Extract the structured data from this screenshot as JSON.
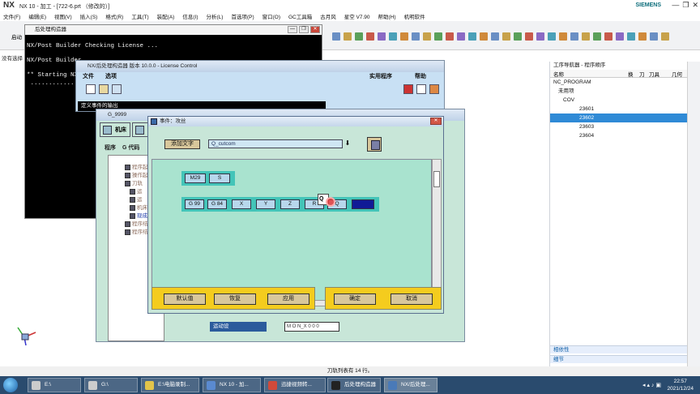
{
  "app": {
    "logo": "NX",
    "title": "NX 10 - 加工 - [722-6.prt （修改的）]",
    "brand": "SIEMENS",
    "window_controls": [
      "—",
      "❐",
      "✕"
    ]
  },
  "menubar": [
    "文件(F)",
    "编辑(E)",
    "视图(V)",
    "插入(S)",
    "格式(R)",
    "工具(T)",
    "装配(A)",
    "信息(I)",
    "分析(L)",
    "首选项(P)",
    "窗口(O)",
    "GC工具箱",
    "古月风",
    "星空 V7.90",
    "帮助(H)",
    "机明软件"
  ],
  "toolbar_left_label": "启动",
  "left_note": "没有选择",
  "console": {
    "title": "后处理构造器",
    "controls": [
      "—",
      "❐",
      "✕"
    ],
    "lines": [
      "NX/Post Builder Checking License ...",
      "",
      "NX/Post Builder",
      "",
      "** Starting NX",
      " ............."
    ]
  },
  "postbuilder": {
    "title": "NX/后处理构造器 版本 10.0.0 - License Control",
    "menu_left": [
      "文件",
      "选项"
    ],
    "menu_right": [
      "实用程序",
      "帮助"
    ],
    "status": "定义事件的输出"
  },
  "g9999": {
    "title": "G_9999",
    "tabs": [
      "机床",
      "程序和刀轨"
    ],
    "subtabs": [
      "程序",
      "G 代码"
    ],
    "tree_items": [
      "程序起",
      "操作起",
      "刀轨",
      "运",
      "运",
      "机床",
      "现成",
      "程序结",
      "程序结"
    ],
    "bottom_label": "运动设",
    "bottom_value": "M O N_X 0 0 0"
  },
  "event_dialog": {
    "title": "事件：攻丝",
    "add_text_label": "添加文字",
    "field_value": "Q_cutcom",
    "field_arrow": "⬇",
    "row1": [
      "M29",
      "S"
    ],
    "row2": [
      "G 99",
      "G 84",
      "X",
      "Y",
      "Z",
      "R",
      "Q"
    ],
    "drag_label": "Q",
    "buttons_left": [
      "默认值",
      "恢复",
      "应用"
    ],
    "buttons_right": [
      "确定",
      "取消"
    ]
  },
  "navigator": {
    "title": "工序导航器 - 程序顺序",
    "columns": [
      "名称",
      "换",
      "刀",
      "刀具",
      "几何"
    ],
    "rows": [
      "NC_PROGRAM",
      "未用项",
      "COV",
      "23601",
      "23602",
      "23603",
      "23604"
    ],
    "selected": "23602",
    "footer": [
      "相依性",
      "细节"
    ]
  },
  "status_bar": "刀轨列表有 14 行。",
  "taskbar": {
    "items": [
      "E:\\",
      "G:\\",
      "E:\\电脑录制...",
      "NX 10 - 加...",
      "迅捷视频转...",
      "后处理构造器",
      "NX/后处理..."
    ],
    "time": "22:57",
    "date": "2021/12/24"
  },
  "colors": {
    "accent": "#2f8ad6",
    "dialog_bg": "#c8e6d8",
    "block_bg": "#43c4b8",
    "button_bar": "#f4cc1e"
  }
}
